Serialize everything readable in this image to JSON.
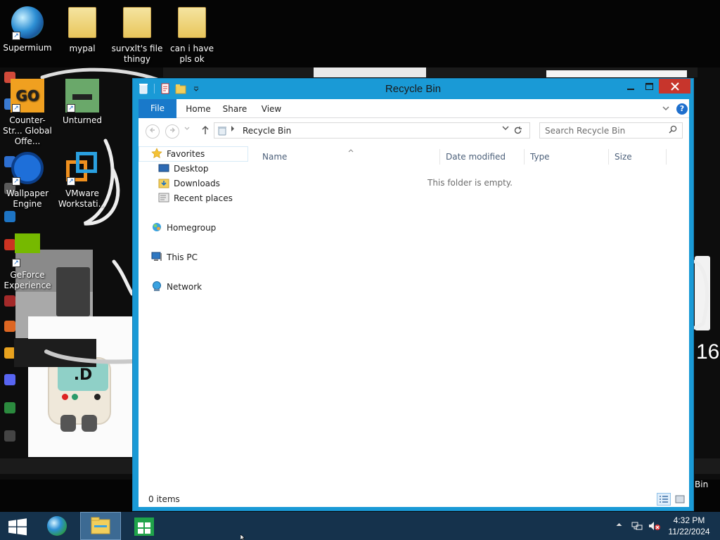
{
  "desktop": {
    "icons": [
      {
        "label": "Supermium",
        "icon": "supermium-browser-icon"
      },
      {
        "label": "mypal",
        "icon": "folder-icon"
      },
      {
        "label": "survxlt's file thingy",
        "icon": "folder-icon"
      },
      {
        "label": "can i have pls ok",
        "icon": "folder-icon"
      }
    ],
    "wallpaper_icons": [
      {
        "label": "Counter-Str... Global Offe...",
        "icon": "csgo-icon"
      },
      {
        "label": "Unturned",
        "icon": "unturned-icon"
      },
      {
        "label": "Wallpaper Engine",
        "icon": "wallpaper-engine-icon"
      },
      {
        "label": "VMware Workstati...",
        "icon": "vmware-icon"
      },
      {
        "label": "GeForce Experience",
        "icon": "nvidia-icon"
      }
    ],
    "right_edge_text": "Bin",
    "right_edge_number": "16",
    "plush_screen_text": ".D"
  },
  "window": {
    "title": "Recycle Bin",
    "ribbon_tabs": [
      "File",
      "Home",
      "Share",
      "View"
    ],
    "help_label": "?",
    "address": {
      "crumb": "Recycle Bin"
    },
    "search": {
      "placeholder": "Search Recycle Bin"
    },
    "nav": {
      "favorites": "Favorites",
      "favorites_items": [
        "Desktop",
        "Downloads",
        "Recent places"
      ],
      "homegroup": "Homegroup",
      "this_pc": "This PC",
      "network": "Network"
    },
    "columns": [
      "Name",
      "Date modified",
      "Type",
      "Size"
    ],
    "empty_message": "This folder is empty.",
    "status": "0 items"
  },
  "taskbar": {
    "time": "4:32 PM",
    "date": "11/22/2024"
  },
  "colors": {
    "window_frame": "#1a9ad6",
    "file_tab": "#1979ca",
    "close_button": "#c7352c",
    "taskbar": "#15324c"
  }
}
